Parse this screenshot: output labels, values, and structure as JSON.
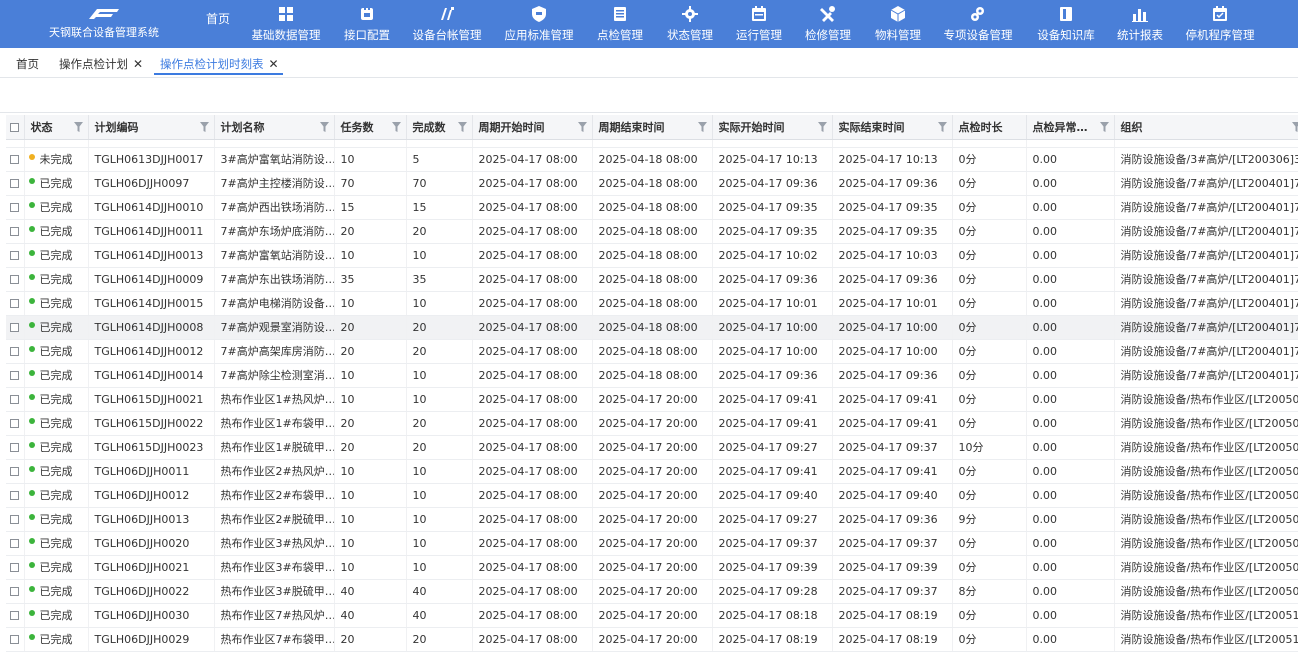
{
  "app": {
    "title": "天钢联合设备管理系统",
    "home": "首页"
  },
  "nav": [
    {
      "label": "基础数据管理",
      "icon": "grid-icon"
    },
    {
      "label": "接口配置",
      "icon": "plug-icon"
    },
    {
      "label": "设备台帐管理",
      "icon": "ledger-icon"
    },
    {
      "label": "应用标准管理",
      "icon": "shield-icon"
    },
    {
      "label": "点检管理",
      "icon": "clipboard-icon"
    },
    {
      "label": "状态管理",
      "icon": "gear-icon"
    },
    {
      "label": "运行管理",
      "icon": "calendar-icon"
    },
    {
      "label": "检修管理",
      "icon": "tools-icon"
    },
    {
      "label": "物料管理",
      "icon": "box-icon"
    },
    {
      "label": "专项设备管理",
      "icon": "gears-icon"
    },
    {
      "label": "设备知识库",
      "icon": "book-icon"
    },
    {
      "label": "统计报表",
      "icon": "bar-chart-icon"
    },
    {
      "label": "停机程序管理",
      "icon": "calendar-check-icon"
    }
  ],
  "tabs": [
    {
      "label": "首页",
      "closable": false,
      "active": false
    },
    {
      "label": "操作点检计划",
      "closable": true,
      "active": false
    },
    {
      "label": "操作点检计划时刻表",
      "closable": true,
      "active": true
    }
  ],
  "columns": [
    "状态",
    "计划编码",
    "计划名称",
    "任务数",
    "完成数",
    "周期开始时间",
    "周期结束时间",
    "实际开始时间",
    "实际结束时间",
    "点检时长",
    "点检异常…",
    "组织"
  ],
  "rows": [
    [
      "未完成",
      "TGLH0613DJJH0017",
      "3#高炉富氧站消防设…",
      "10",
      "5",
      "2025-04-17 08:00",
      "2025-04-18 08:00",
      "2025-04-17 10:13",
      "2025-04-17 10:13",
      "0分",
      "0.00",
      "消防设施设备/3#高炉/[LT200306]3…"
    ],
    [
      "已完成",
      "TGLH06DJJH0097",
      "7#高炉主控楼消防设…",
      "70",
      "70",
      "2025-04-17 08:00",
      "2025-04-18 08:00",
      "2025-04-17 09:36",
      "2025-04-17 09:36",
      "0分",
      "0.00",
      "消防设施设备/7#高炉/[LT200401]7…"
    ],
    [
      "已完成",
      "TGLH0614DJJH0010",
      "7#高炉西出铁场消防…",
      "15",
      "15",
      "2025-04-17 08:00",
      "2025-04-18 08:00",
      "2025-04-17 09:35",
      "2025-04-17 09:35",
      "0分",
      "0.00",
      "消防设施设备/7#高炉/[LT200401]7…"
    ],
    [
      "已完成",
      "TGLH0614DJJH0011",
      "7#高炉东场炉底消防…",
      "20",
      "20",
      "2025-04-17 08:00",
      "2025-04-18 08:00",
      "2025-04-17 09:35",
      "2025-04-17 09:35",
      "0分",
      "0.00",
      "消防设施设备/7#高炉/[LT200401]7…"
    ],
    [
      "已完成",
      "TGLH0614DJJH0013",
      "7#高炉富氧站消防设…",
      "10",
      "10",
      "2025-04-17 08:00",
      "2025-04-18 08:00",
      "2025-04-17 10:02",
      "2025-04-17 10:03",
      "0分",
      "0.00",
      "消防设施设备/7#高炉/[LT200401]7…"
    ],
    [
      "已完成",
      "TGLH0614DJJH0009",
      "7#高炉东出铁场消防…",
      "35",
      "35",
      "2025-04-17 08:00",
      "2025-04-18 08:00",
      "2025-04-17 09:36",
      "2025-04-17 09:36",
      "0分",
      "0.00",
      "消防设施设备/7#高炉/[LT200401]7…"
    ],
    [
      "已完成",
      "TGLH0614DJJH0015",
      "7#高炉电梯消防设备…",
      "10",
      "10",
      "2025-04-17 08:00",
      "2025-04-18 08:00",
      "2025-04-17 10:01",
      "2025-04-17 10:01",
      "0分",
      "0.00",
      "消防设施设备/7#高炉/[LT200401]7…"
    ],
    [
      "已完成",
      "TGLH0614DJJH0008",
      "7#高炉观景室消防设…",
      "20",
      "20",
      "2025-04-17 08:00",
      "2025-04-18 08:00",
      "2025-04-17 10:00",
      "2025-04-17 10:00",
      "0分",
      "0.00",
      "消防设施设备/7#高炉/[LT200401]7…"
    ],
    [
      "已完成",
      "TGLH0614DJJH0012",
      "7#高炉高架库房消防…",
      "20",
      "20",
      "2025-04-17 08:00",
      "2025-04-18 08:00",
      "2025-04-17 10:00",
      "2025-04-17 10:00",
      "0分",
      "0.00",
      "消防设施设备/7#高炉/[LT200401]7…"
    ],
    [
      "已完成",
      "TGLH0614DJJH0014",
      "7#高炉除尘检测室消…",
      "10",
      "10",
      "2025-04-17 08:00",
      "2025-04-18 08:00",
      "2025-04-17 09:36",
      "2025-04-17 09:36",
      "0分",
      "0.00",
      "消防设施设备/7#高炉/[LT200401]7…"
    ],
    [
      "已完成",
      "TGLH0615DJJH0021",
      "热布作业区1#热风炉…",
      "10",
      "10",
      "2025-04-17 08:00",
      "2025-04-17 20:00",
      "2025-04-17 09:41",
      "2025-04-17 09:41",
      "0分",
      "0.00",
      "消防设施设备/热布作业区/[LT20050…"
    ],
    [
      "已完成",
      "TGLH0615DJJH0022",
      "热布作业区1#布袋甲…",
      "20",
      "20",
      "2025-04-17 08:00",
      "2025-04-17 20:00",
      "2025-04-17 09:41",
      "2025-04-17 09:41",
      "0分",
      "0.00",
      "消防设施设备/热布作业区/[LT20050…"
    ],
    [
      "已完成",
      "TGLH0615DJJH0023",
      "热布作业区1#脱硫甲…",
      "20",
      "20",
      "2025-04-17 08:00",
      "2025-04-17 20:00",
      "2025-04-17 09:27",
      "2025-04-17 09:37",
      "10分",
      "0.00",
      "消防设施设备/热布作业区/[LT20050…"
    ],
    [
      "已完成",
      "TGLH06DJJH0011",
      "热布作业区2#热风炉…",
      "10",
      "10",
      "2025-04-17 08:00",
      "2025-04-17 20:00",
      "2025-04-17 09:41",
      "2025-04-17 09:41",
      "0分",
      "0.00",
      "消防设施设备/热布作业区/[LT20050…"
    ],
    [
      "已完成",
      "TGLH06DJJH0012",
      "热布作业区2#布袋甲…",
      "10",
      "10",
      "2025-04-17 08:00",
      "2025-04-17 20:00",
      "2025-04-17 09:40",
      "2025-04-17 09:40",
      "0分",
      "0.00",
      "消防设施设备/热布作业区/[LT20050…"
    ],
    [
      "已完成",
      "TGLH06DJJH0013",
      "热布作业区2#脱硫甲…",
      "10",
      "10",
      "2025-04-17 08:00",
      "2025-04-17 20:00",
      "2025-04-17 09:27",
      "2025-04-17 09:36",
      "9分",
      "0.00",
      "消防设施设备/热布作业区/[LT20050…"
    ],
    [
      "已完成",
      "TGLH06DJJH0020",
      "热布作业区3#热风炉…",
      "10",
      "10",
      "2025-04-17 08:00",
      "2025-04-17 20:00",
      "2025-04-17 09:37",
      "2025-04-17 09:37",
      "0分",
      "0.00",
      "消防设施设备/热布作业区/[LT20050…"
    ],
    [
      "已完成",
      "TGLH06DJJH0021",
      "热布作业区3#布袋甲…",
      "10",
      "10",
      "2025-04-17 08:00",
      "2025-04-17 20:00",
      "2025-04-17 09:39",
      "2025-04-17 09:39",
      "0分",
      "0.00",
      "消防设施设备/热布作业区/[LT20050…"
    ],
    [
      "已完成",
      "TGLH06DJJH0022",
      "热布作业区3#脱硫甲…",
      "40",
      "40",
      "2025-04-17 08:00",
      "2025-04-17 20:00",
      "2025-04-17 09:28",
      "2025-04-17 09:37",
      "8分",
      "0.00",
      "消防设施设备/热布作业区/[LT20050…"
    ],
    [
      "已完成",
      "TGLH06DJJH0030",
      "热布作业区7#热风炉…",
      "40",
      "40",
      "2025-04-17 08:00",
      "2025-04-17 20:00",
      "2025-04-17 08:18",
      "2025-04-17 08:19",
      "0分",
      "0.00",
      "消防设施设备/热布作业区/[LT20051…"
    ],
    [
      "已完成",
      "TGLH06DJJH0029",
      "热布作业区7#布袋甲…",
      "20",
      "20",
      "2025-04-17 08:00",
      "2025-04-17 20:00",
      "2025-04-17 08:19",
      "2025-04-17 08:19",
      "0分",
      "0.00",
      "消防设施设备/热布作业区/[LT20051…"
    ]
  ],
  "highlighted_row": 7,
  "colors": {
    "header": "#4a7fd8",
    "active_tab": "#3c7be0",
    "done": "#3cb43c",
    "pending": "#f0b020"
  }
}
